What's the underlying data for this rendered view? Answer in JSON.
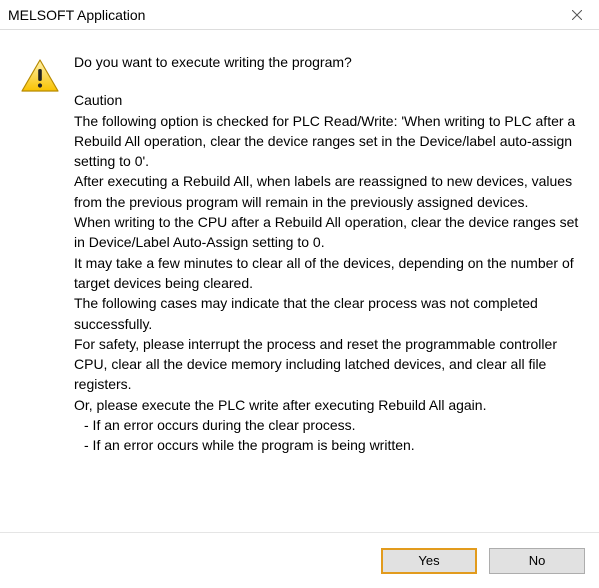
{
  "title": "MELSOFT Application",
  "message": {
    "question": "Do you want to execute writing the program?",
    "caution_heading": "Caution",
    "p1": "The following option is checked for PLC Read/Write: 'When writing to PLC after a Rebuild All operation, clear the device ranges set in the Device/label auto-assign setting to 0'.",
    "p2": "After executing a Rebuild All, when labels are reassigned to new devices, values from the previous program will remain in the previously assigned devices.",
    "p3": "When writing to the CPU after a Rebuild All operation, clear the device ranges set in Device/Label Auto-Assign setting to 0.",
    "p4": "It may take a few minutes to clear all of the devices, depending on the number of target devices being cleared.",
    "p5": "The following cases may indicate that the clear process was not completed successfully.",
    "p6": "For safety, please interrupt the process and reset the programmable controller CPU, clear all the device memory including latched devices, and clear all file registers.",
    "p7": "Or, please execute the PLC write after executing Rebuild All again.",
    "bullet1": "- If an error occurs during the clear process.",
    "bullet2": "- If an error occurs while the program is being written."
  },
  "buttons": {
    "yes": "Yes",
    "no": "No"
  }
}
